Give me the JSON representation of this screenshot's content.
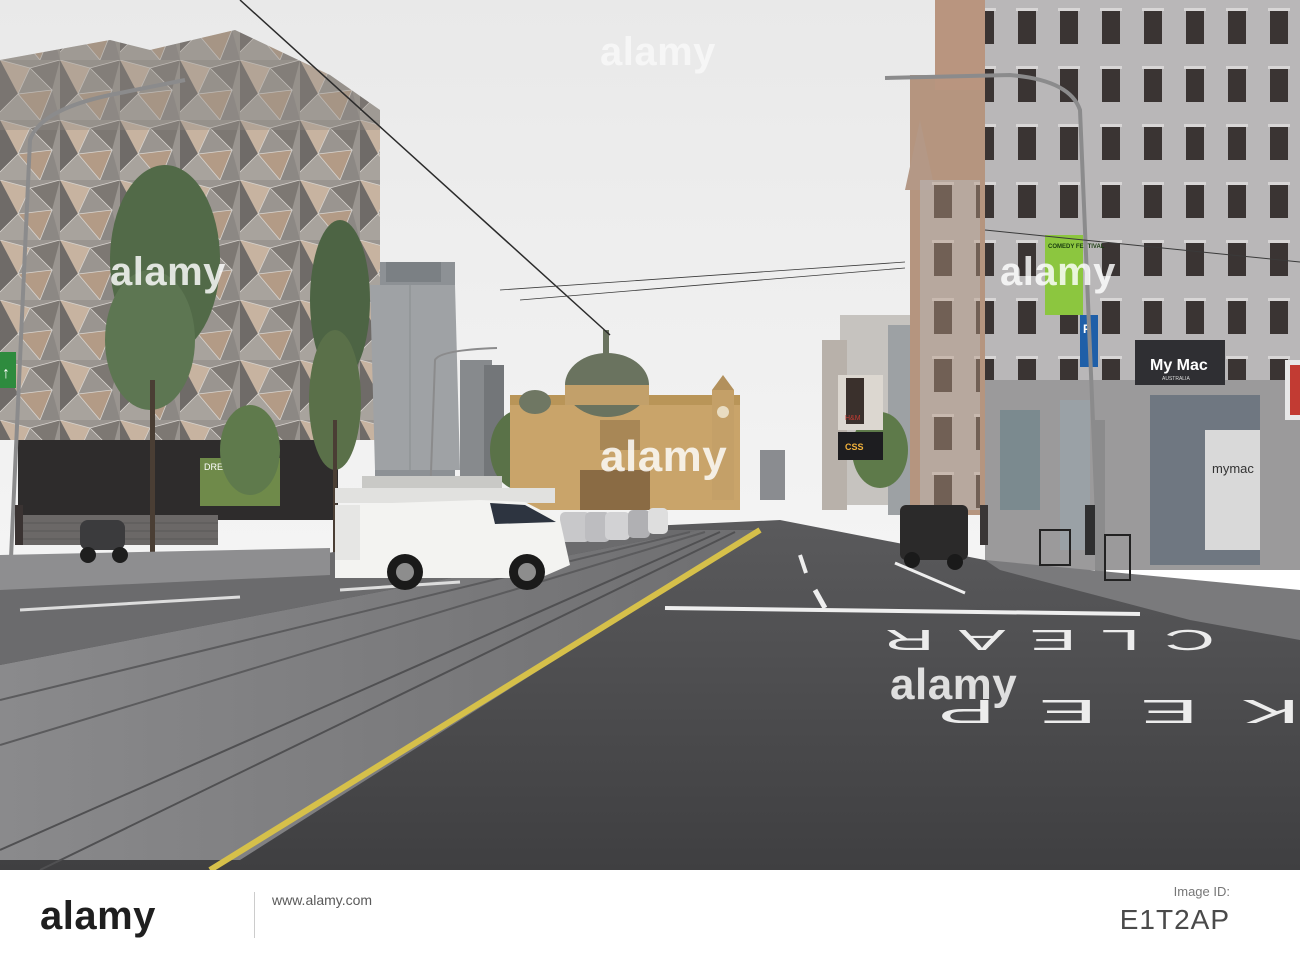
{
  "photo": {
    "description_colors": {
      "sky": "#ececec",
      "road": "#4a4a4c",
      "tram_lane": "#7e7e80",
      "building_grey": "#8e8e91",
      "station_sandstone": "#c9a46a",
      "dome": "#6a735f",
      "van": "#f3f3f1"
    },
    "road_markings": {
      "keep": "KEEP",
      "clear": "CLEAR"
    },
    "store_signs": {
      "mymac": "My Mac",
      "mymac_sub": "AUSTRALIA",
      "mymac_window": "mymac",
      "banner": "COMEDY FESTIVAL",
      "dream": "DREAM ANI",
      "hm": "H&M",
      "cs": "CSS"
    }
  },
  "watermarks": {
    "center_top": "alamy",
    "left": "alamy",
    "right": "alamy",
    "center": "alamy",
    "bottom": "alamy"
  },
  "footer": {
    "logo": "alamy",
    "image_id": "E1T2AP",
    "id_label": "Image ID:",
    "www": "www.alamy.com"
  }
}
